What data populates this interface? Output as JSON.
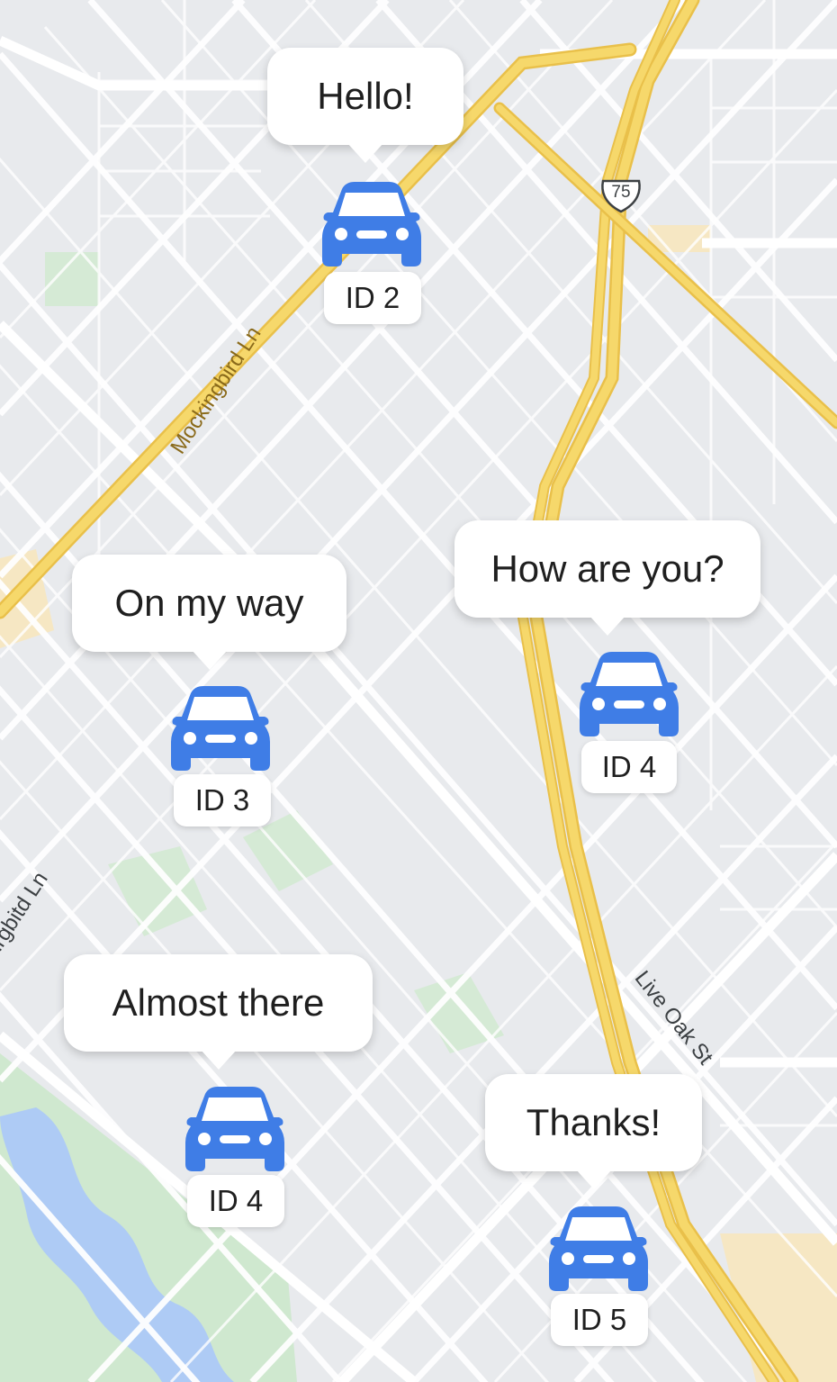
{
  "map": {
    "road_labels": {
      "mockingbird": "Mockingbird Ln",
      "mockingbird_partial": "irgbitd Ln",
      "live_oak": "Live Oak St"
    },
    "highway_shield": "75",
    "colors": {
      "background": "#e8eaed",
      "street": "#ffffff",
      "highway": "#f6d86b",
      "highway_edge": "#e9c04a",
      "park": "#cfe8cf",
      "water": "#aecbf5",
      "sand": "#f6e7c3",
      "car": "#3f7de6"
    }
  },
  "vehicles": [
    {
      "id": "ID 2",
      "message": "Hello!"
    },
    {
      "id": "ID 3",
      "message": "On my way"
    },
    {
      "id": "ID 4",
      "message": "How are you?"
    },
    {
      "id": "ID 4",
      "message": "Almost there"
    },
    {
      "id": "ID 5",
      "message": "Thanks!"
    }
  ]
}
